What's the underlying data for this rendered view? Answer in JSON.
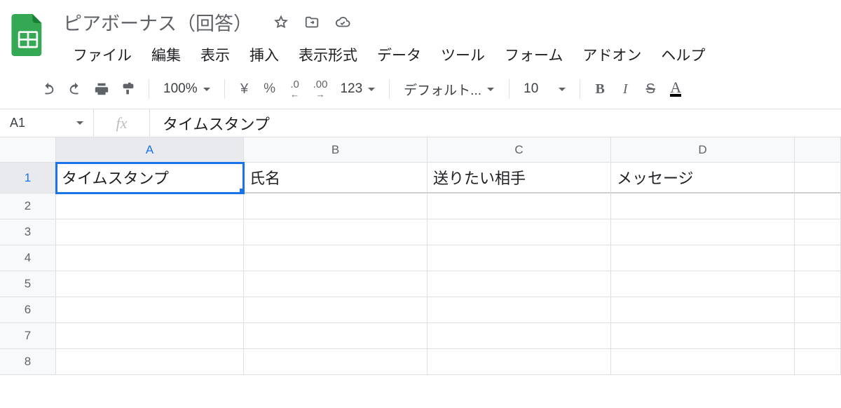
{
  "doc": {
    "title": "ピアボーナス（回答）"
  },
  "menu": [
    "ファイル",
    "編集",
    "表示",
    "挿入",
    "表示形式",
    "データ",
    "ツール",
    "フォーム",
    "アドオン",
    "ヘルプ"
  ],
  "toolbar": {
    "zoom": "100%",
    "currency": "¥",
    "percent": "%",
    "dec_less": ".0",
    "dec_more": ".00",
    "more_formats": "123",
    "font": "デフォルト...",
    "font_size": "10",
    "bold": "B",
    "italic": "I",
    "strike": "S",
    "textcolor": "A"
  },
  "name_box": "A1",
  "fx": "タイムスタンプ",
  "columns": [
    "A",
    "B",
    "C",
    "D",
    ""
  ],
  "active_col": "A",
  "active_row": 1,
  "row_count": 8,
  "cells": {
    "r1": {
      "A": "タイムスタンプ",
      "B": "氏名",
      "C": "送りたい相手",
      "D": "メッセージ"
    }
  }
}
